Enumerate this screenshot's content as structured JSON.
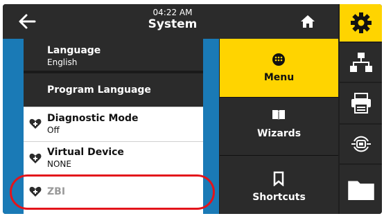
{
  "header": {
    "time": "04:22 AM",
    "title": "System"
  },
  "list": {
    "items": [
      {
        "label": "Language",
        "value": "English",
        "style": "dark",
        "icon": "none"
      },
      {
        "label": "Program Language",
        "value": "",
        "style": "dark",
        "icon": "none"
      },
      {
        "label": "Diagnostic Mode",
        "value": "Off",
        "style": "light",
        "icon": "favorite-plus-icon"
      },
      {
        "label": "Virtual Device",
        "value": "NONE",
        "style": "light",
        "icon": "favorite-plus-icon"
      },
      {
        "label": "ZBI",
        "value": "",
        "style": "disabled",
        "icon": "favorite-plus-icon"
      }
    ]
  },
  "menu": {
    "items": [
      {
        "label": "Menu",
        "icon": "menu-dots-icon",
        "active": true
      },
      {
        "label": "Wizards",
        "icon": "book-icon",
        "active": false
      },
      {
        "label": "Shortcuts",
        "icon": "bookmark-icon",
        "active": false
      }
    ]
  },
  "sidebar": {
    "icons": [
      "gear-icon",
      "network-icon",
      "printer-icon",
      "connectivity-icon",
      "folder-icon"
    ]
  },
  "colors": {
    "accent": "#ffd400",
    "highlight": "#e3141b",
    "list_edge": "#1a7ab6",
    "panel": "#2b2b2b"
  }
}
